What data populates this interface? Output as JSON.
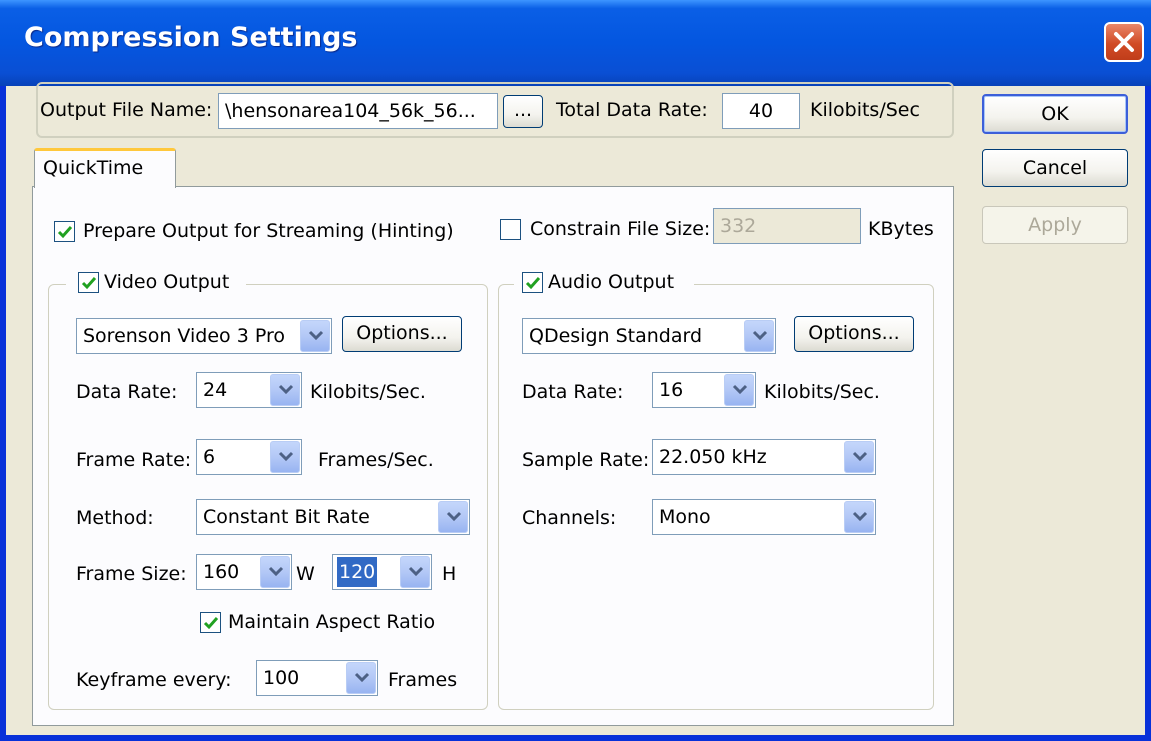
{
  "window": {
    "title": "Compression Settings"
  },
  "header": {
    "output_file_label": "Output File Name:",
    "output_file_value": "\\hensonarea104_56k_56...",
    "browse_label": "...",
    "total_data_rate_label": "Total Data Rate:",
    "total_data_rate_value": "40",
    "total_data_rate_unit": "Kilobits/Sec"
  },
  "buttons": {
    "ok": "OK",
    "cancel": "Cancel",
    "apply": "Apply"
  },
  "tabs": [
    {
      "label": "QuickTime",
      "selected": true
    }
  ],
  "streaming": {
    "prepare_label": "Prepare Output for Streaming (Hinting)",
    "prepare_checked": true,
    "constrain_label": "Constrain File Size:",
    "constrain_checked": false,
    "constrain_value": "332",
    "constrain_unit": "KBytes"
  },
  "video": {
    "enabled_label": "Video Output",
    "enabled": true,
    "codec": "Sorenson Video 3 Pro",
    "options_label": "Options...",
    "data_rate_label": "Data Rate:",
    "data_rate_value": "24",
    "data_rate_unit": "Kilobits/Sec.",
    "frame_rate_label": "Frame Rate:",
    "frame_rate_value": "6",
    "frame_rate_unit": "Frames/Sec.",
    "method_label": "Method:",
    "method_value": "Constant Bit Rate",
    "frame_size_label": "Frame Size:",
    "width_value": "160",
    "width_unit": "W",
    "height_value": "120",
    "height_unit": "H",
    "aspect_label": "Maintain Aspect Ratio",
    "aspect_checked": true,
    "keyframe_label": "Keyframe every:",
    "keyframe_value": "100",
    "keyframe_unit": "Frames"
  },
  "audio": {
    "enabled_label": "Audio Output",
    "enabled": true,
    "codec": "QDesign Standard",
    "options_label": "Options...",
    "data_rate_label": "Data Rate:",
    "data_rate_value": "16",
    "data_rate_unit": "Kilobits/Sec.",
    "sample_rate_label": "Sample Rate:",
    "sample_rate_value": "22.050 kHz",
    "channels_label": "Channels:",
    "channels_value": "Mono"
  },
  "colors": {
    "titlebar": "#0a5fe6",
    "dialog_bg": "#ece9d8",
    "tab_accent": "#ffc83c",
    "check_green": "#21a121",
    "selection": "#316ac5"
  },
  "icons": {
    "close": "close-x-icon",
    "dropdown": "chevron-down-icon",
    "check": "checkmark-icon"
  }
}
